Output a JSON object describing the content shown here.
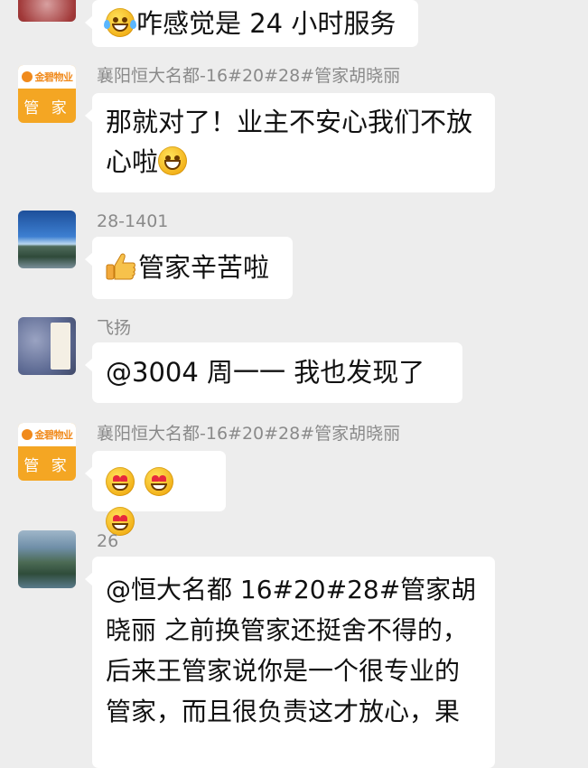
{
  "messages": [
    {
      "sender": "",
      "text": "咋感觉是 24 小时服务",
      "lead_icon": "laughing-tears-emoji"
    },
    {
      "sender": "襄阳恒大名都-16#20#28#管家胡晓丽",
      "avatar_brand": "金碧物业",
      "avatar_label": "管 家",
      "line1": "那就对了！业主不安心我们不放",
      "line2": "心啦",
      "trail_icon": "grinning-emoji"
    },
    {
      "sender": "28-1401",
      "text": "管家辛苦啦",
      "lead_icon": "thumbs-up-emoji"
    },
    {
      "sender": "飞扬",
      "text": "@3004  周一一  我也发现了"
    },
    {
      "sender": "襄阳恒大名都-16#20#28#管家胡晓丽",
      "avatar_brand": "金碧物业",
      "avatar_label": "管 家",
      "icons": [
        "heart-eyes-emoji",
        "heart-eyes-emoji",
        "heart-eyes-emoji"
      ]
    },
    {
      "sender": "26",
      "lines": [
        "@恒大名都 16#20#28#管家胡",
        "晓丽  之前换管家还挺舍不得的，",
        "后来王管家说你是一个很专业的",
        "管家，而且很负责这才放心，果"
      ]
    }
  ],
  "colors": {
    "background": "#ededed",
    "bubble": "#ffffff",
    "sender_name": "#8a8a8a",
    "avatar_orange": "#f4a623"
  }
}
